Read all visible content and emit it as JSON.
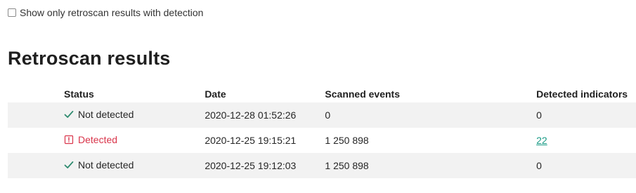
{
  "filter": {
    "label": "Show only retroscan results with detection",
    "checked": false
  },
  "page_title": "Retroscan results",
  "table": {
    "headers": {
      "status": "Status",
      "date": "Date",
      "scanned_events": "Scanned events",
      "detected_indicators": "Detected indicators"
    },
    "rows": [
      {
        "status": "Not detected",
        "status_icon": "check-icon",
        "date": "2020-12-28 01:52:26",
        "scanned_events": "0",
        "detected_indicators": "0",
        "indicators_link": false
      },
      {
        "status": "Detected",
        "status_icon": "alert-icon",
        "date": "2020-12-25 19:15:21",
        "scanned_events": "1 250 898",
        "detected_indicators": "22",
        "indicators_link": true
      },
      {
        "status": "Not detected",
        "status_icon": "check-icon",
        "date": "2020-12-25 19:12:03",
        "scanned_events": "1 250 898",
        "detected_indicators": "0",
        "indicators_link": false
      }
    ]
  },
  "colors": {
    "ok": "#2d8a6e",
    "detected": "#d9344a",
    "link": "#1a9b86",
    "row_stripe": "#f2f2f2"
  }
}
